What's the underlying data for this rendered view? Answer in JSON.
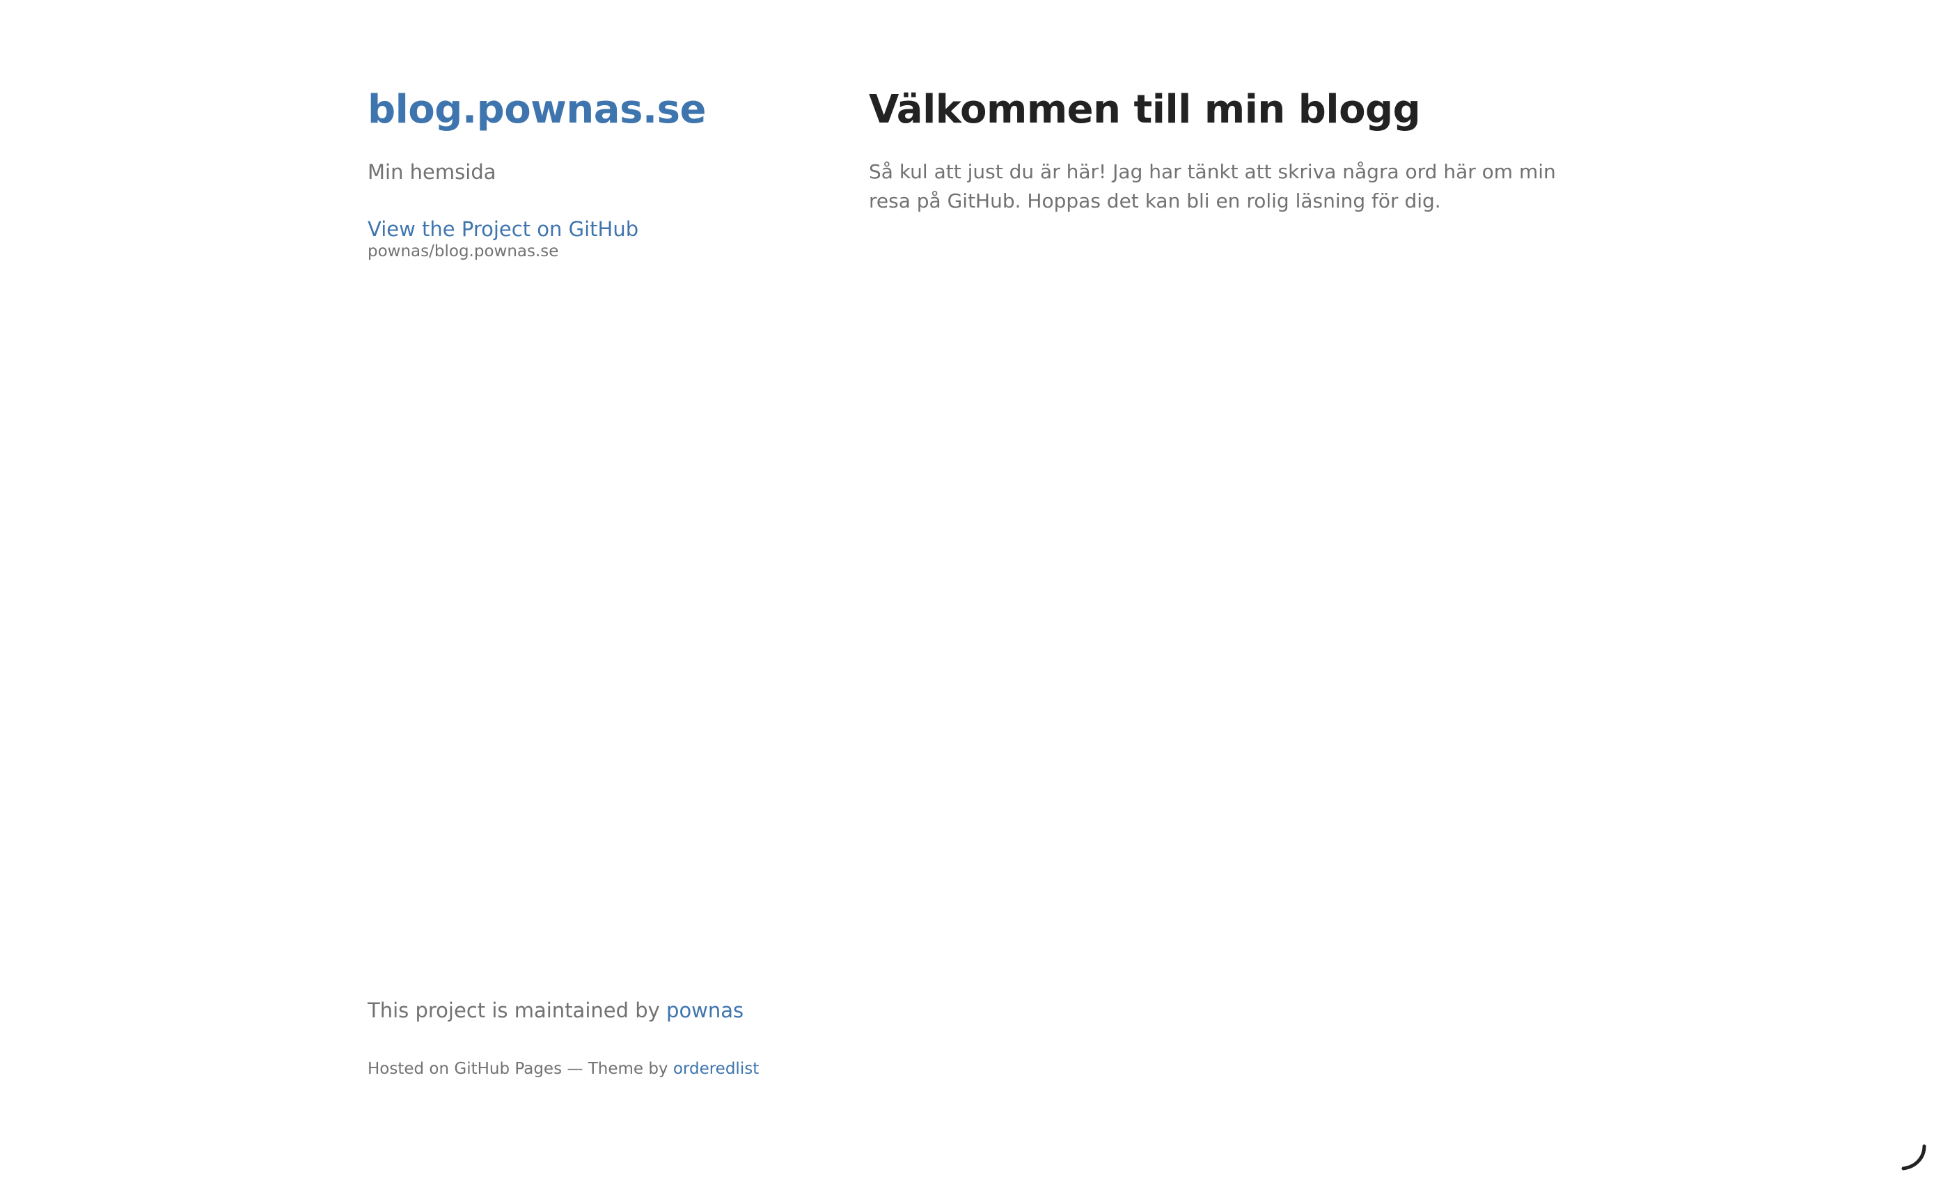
{
  "sidebar": {
    "site_title": "blog.pownas.se",
    "description": "Min hemsida",
    "github_link": "View the Project on GitHub",
    "github_repo": "pownas/blog.pownas.se"
  },
  "main": {
    "heading": "Välkommen till min blogg",
    "text": "Så kul att just du är här! Jag har tänkt att skriva några ord här om min resa på GitHub. Hoppas det kan bli en rolig läsning för dig."
  },
  "footer": {
    "maintained_prefix": "This project is maintained by",
    "maintainer_name": "pownas",
    "hosted_prefix": "Hosted on GitHub Pages — Theme by",
    "theme_name": "orderedlist"
  },
  "icons": {
    "spinner": "loading-spinner-icon"
  },
  "colors": {
    "link": "#3f75ae",
    "heading": "#222222",
    "text": "#727272",
    "background": "#ffffff"
  }
}
